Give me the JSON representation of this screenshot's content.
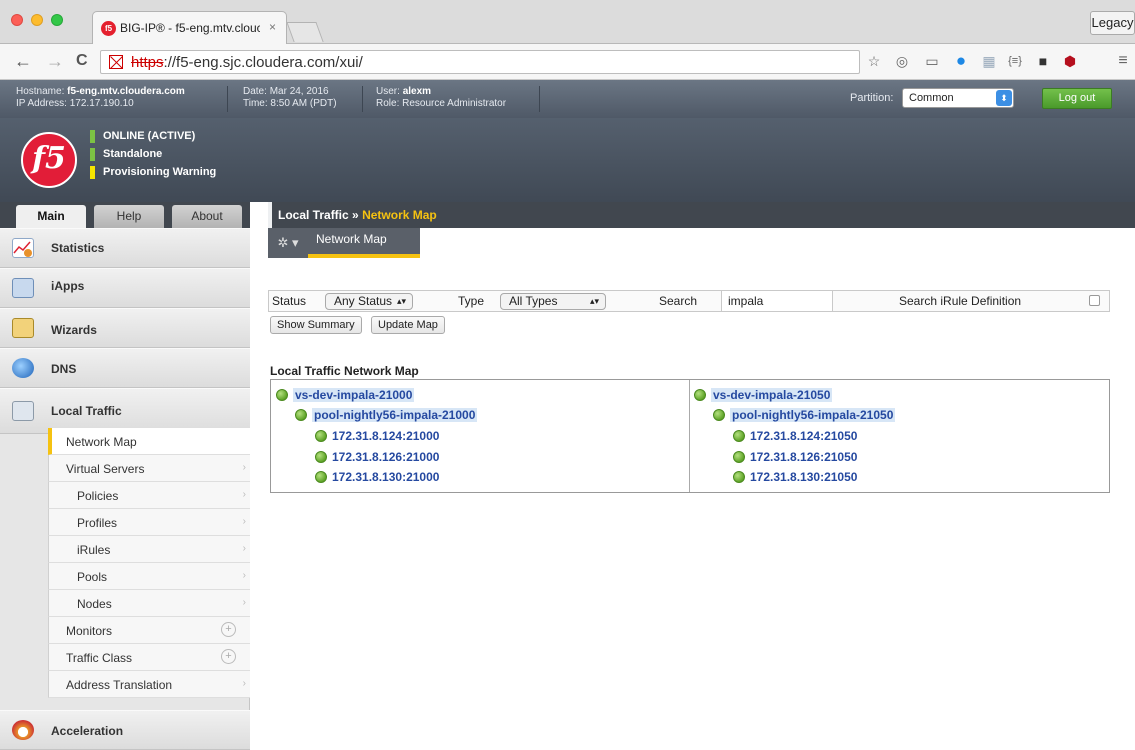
{
  "browser": {
    "tab_title": "BIG-IP® - f5-eng.mtv.clouc",
    "tab_favicon_text": "f5",
    "tab_close": "×",
    "legacy_label": "Legacy",
    "url_scheme": "https",
    "url_rest": "://f5-eng.sjc.cloudera.com/xui/",
    "back": "←",
    "forward": "→",
    "reload": "C",
    "menu": "≡",
    "extension_icons": [
      "star-icon",
      "sync-icon",
      "cast-icon",
      "circle-icon",
      "grid-icon",
      "braces-icon",
      "square-icon",
      "ublock-icon"
    ]
  },
  "header": {
    "hostname_label": "Hostname:",
    "hostname": "f5-eng.mtv.cloudera.com",
    "ip_label": "IP Address:",
    "ip": "172.17.190.10",
    "date_label": "Date:",
    "date": "Mar 24, 2016",
    "time_label": "Time:",
    "time": "8:50 AM (PDT)",
    "user_label": "User:",
    "user": "alexm",
    "role_label": "Role:",
    "role": "Resource Administrator",
    "partition_label": "Partition:",
    "partition_value": "Common",
    "logout_label": "Log out"
  },
  "banner": {
    "logo_text": "f5",
    "status": [
      "ONLINE (ACTIVE)",
      "Standalone",
      "Provisioning Warning"
    ]
  },
  "nav_tabs": [
    "Main",
    "Help",
    "About"
  ],
  "sidebar": {
    "sections": [
      "Statistics",
      "iApps",
      "Wizards",
      "DNS",
      "Local Traffic",
      "Acceleration"
    ],
    "local_traffic_items": [
      {
        "label": "Network Map",
        "active": true
      },
      {
        "label": "Virtual Servers"
      },
      {
        "label": "Policies"
      },
      {
        "label": "Profiles"
      },
      {
        "label": "iRules"
      },
      {
        "label": "Pools"
      },
      {
        "label": "Nodes"
      },
      {
        "label": "Monitors"
      },
      {
        "label": "Traffic Class"
      },
      {
        "label": "Address Translation"
      }
    ]
  },
  "breadcrumb": {
    "parent": "Local Traffic",
    "separator": "»",
    "current": "Network Map"
  },
  "subtab": "Network Map",
  "filters": {
    "status_label": "Status",
    "status_value": "Any Status",
    "type_label": "Type",
    "type_value": "All Types",
    "search_label": "Search",
    "search_value": "impala",
    "irule_label": "Search iRule Definition"
  },
  "buttons": {
    "show_summary": "Show Summary",
    "update_map": "Update Map"
  },
  "map": {
    "title": "Local Traffic Network Map",
    "columns": [
      {
        "virtual_server": "vs-dev-impala-21000",
        "pool": "pool-nightly56-impala-21000",
        "members": [
          "172.31.8.124:21000",
          "172.31.8.126:21000",
          "172.31.8.130:21000"
        ]
      },
      {
        "virtual_server": "vs-dev-impala-21050",
        "pool": "pool-nightly56-impala-21050",
        "members": [
          "172.31.8.124:21050",
          "172.31.8.126:21050",
          "172.31.8.130:21050"
        ]
      }
    ]
  },
  "colors": {
    "accent_yellow": "#f5c211",
    "status_green": "#5fa428",
    "link_blue": "#2549a0",
    "logout_green": "#4a9a2b"
  }
}
